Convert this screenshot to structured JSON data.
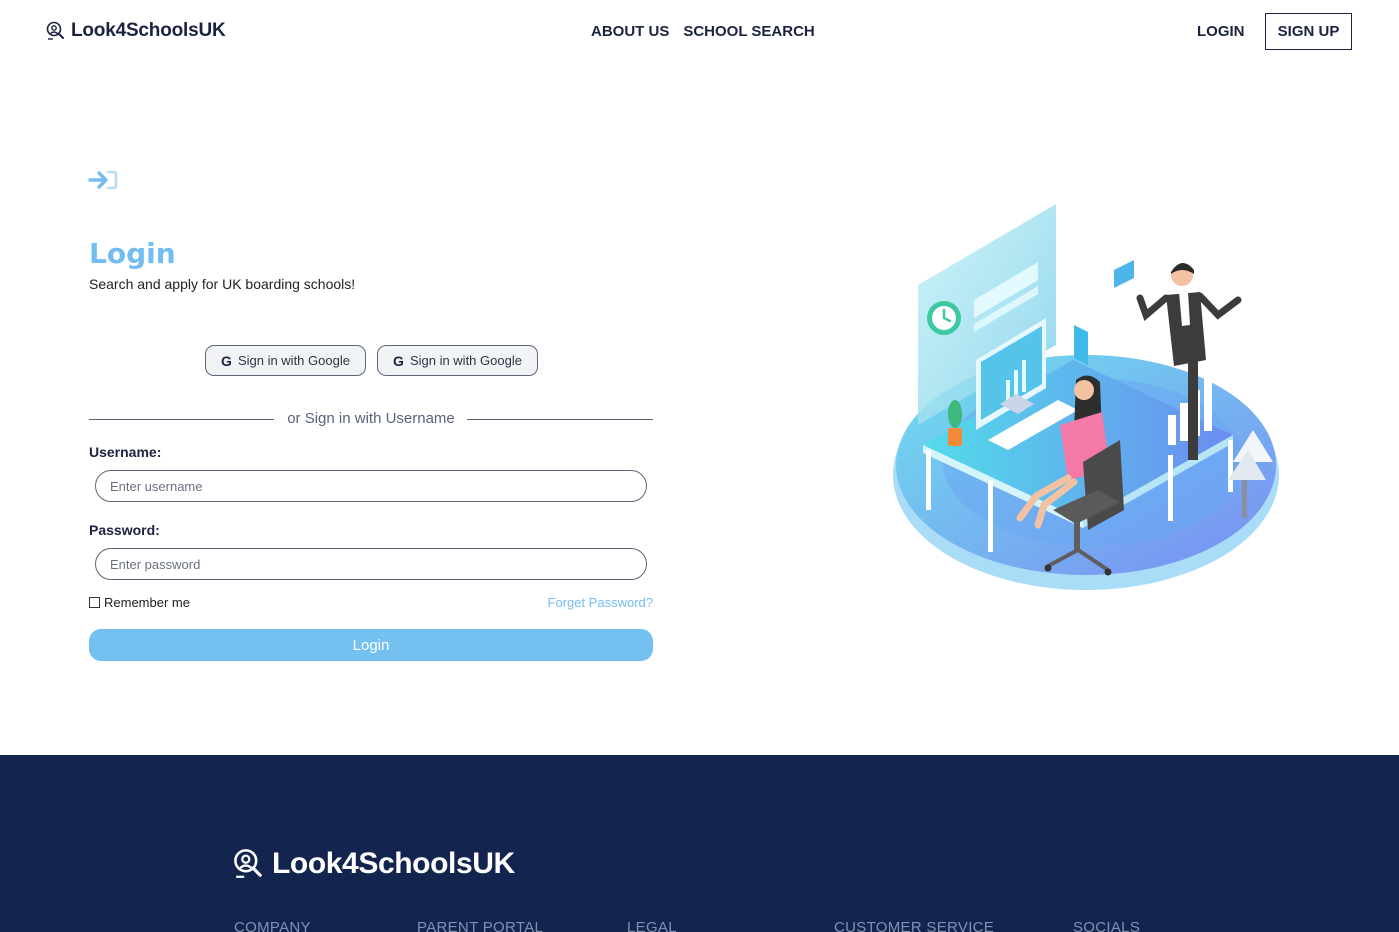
{
  "header": {
    "brand": "Look4SchoolsUK",
    "nav": [
      "ABOUT US",
      "SCHOOL SEARCH"
    ],
    "login": "LOGIN",
    "signup": "SIGN UP"
  },
  "login_form": {
    "title": "Login",
    "subtitle": "Search and apply for UK boarding schools!",
    "google_buttons": [
      "Sign in with Google",
      "Sign in with Google"
    ],
    "divider_text": "or Sign in with Username",
    "username_label": "Username:",
    "username_placeholder": "Enter username",
    "password_label": "Password:",
    "password_placeholder": "Enter password",
    "remember_label": "Remember me",
    "forgot_label": "Forget Password?",
    "submit_label": "Login"
  },
  "footer": {
    "brand": "Look4SchoolsUK",
    "columns": [
      "COMPANY",
      "PARENT PORTAL",
      "LEGAL",
      "CUSTOMER SERVICE",
      "SOCIALS"
    ]
  },
  "colors": {
    "navy": "#13244e",
    "accent_blue": "#74bdf0",
    "text_dark": "#1b2340"
  },
  "icons": {
    "brand_logo": "school-search-icon",
    "login": "sign-in-arrow-icon",
    "google": "google-g-icon"
  }
}
